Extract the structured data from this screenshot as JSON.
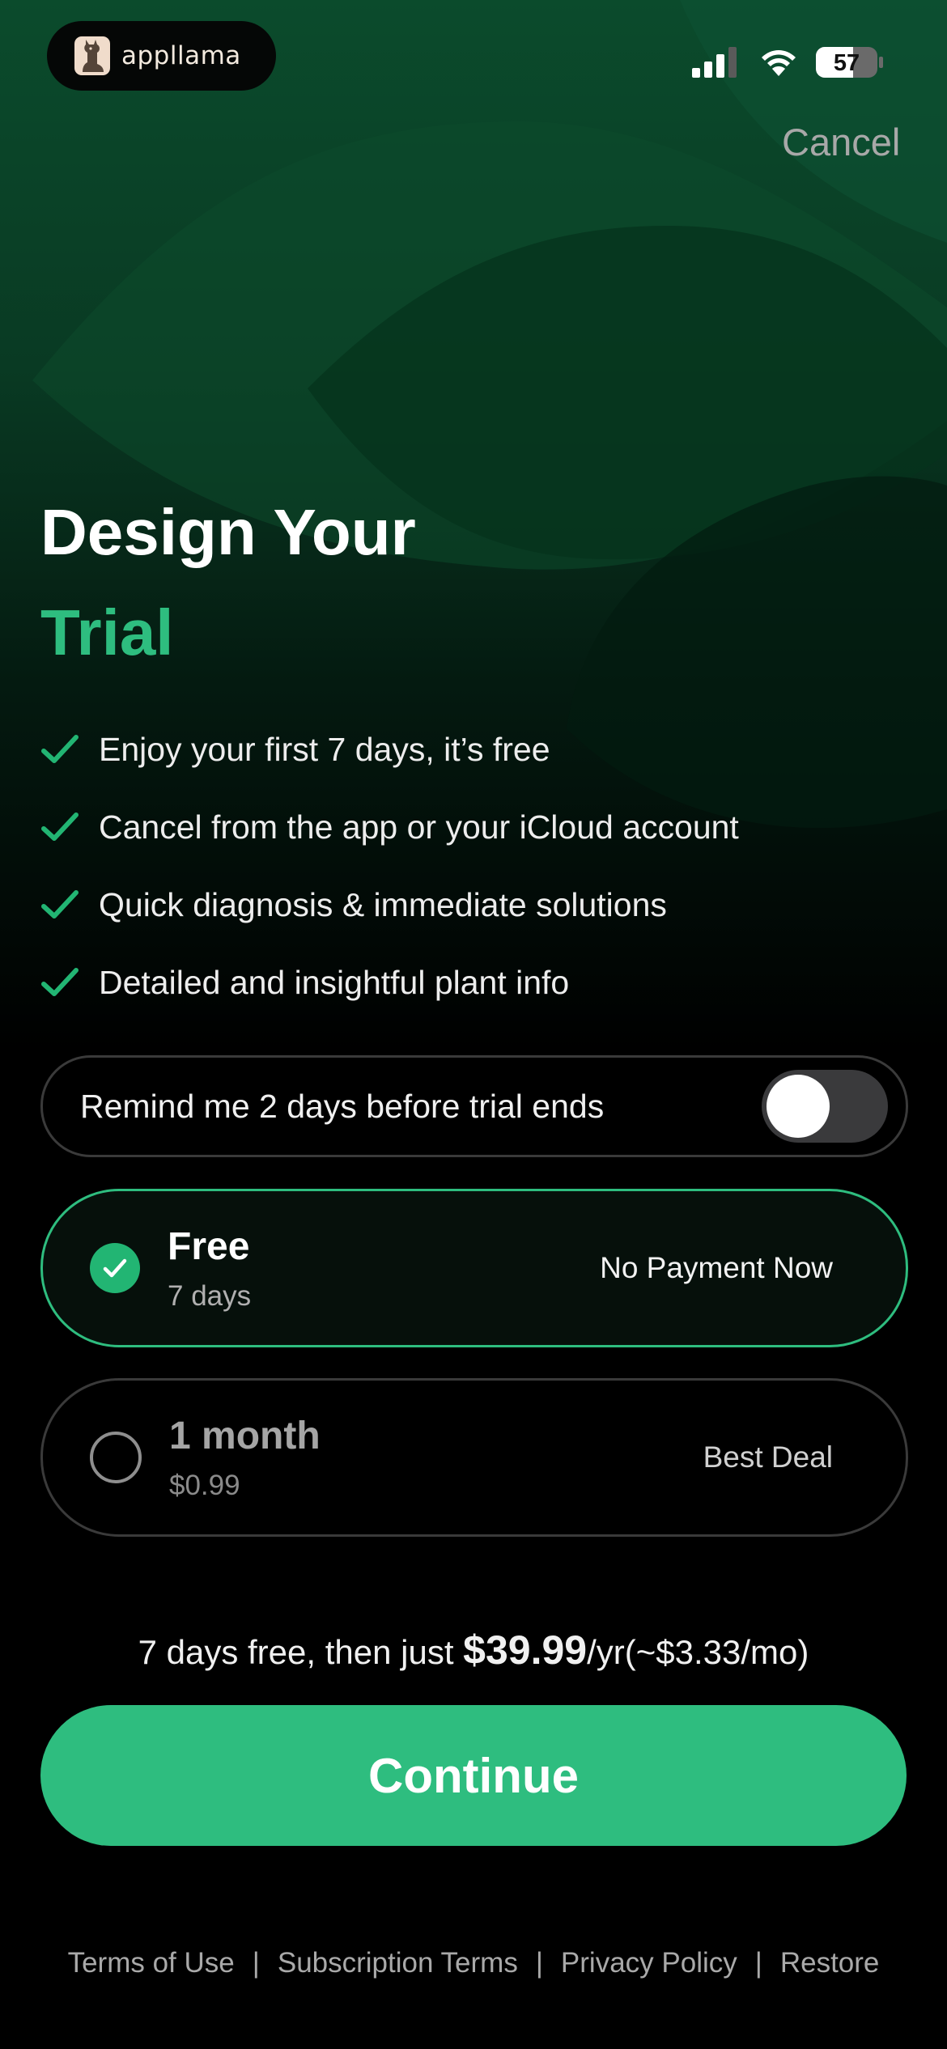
{
  "status_bar": {
    "app_name": "appllama",
    "battery": "57"
  },
  "header": {
    "cancel_label": "Cancel"
  },
  "hero": {
    "title_line1": "Design Your",
    "title_line2": "Trial"
  },
  "features": [
    "Enjoy your first 7 days, it’s free",
    "Cancel from the app or your iCloud account",
    "Quick diagnosis & immediate solutions",
    "Detailed and insightful plant info"
  ],
  "reminder": {
    "label": "Remind me 2 days before trial ends",
    "enabled": false
  },
  "plans": [
    {
      "name": "Free",
      "subtitle": "7 days",
      "badge": "No Payment Now",
      "selected": true
    },
    {
      "name": "1 month",
      "subtitle": "$0.99",
      "badge": "Best Deal",
      "selected": false
    }
  ],
  "pricing": {
    "prefix": "7 days free, then just ",
    "price": "$39.99",
    "suffix": "/yr(~$3.33/mo)"
  },
  "cta": {
    "continue_label": "Continue"
  },
  "footer": {
    "links": [
      "Terms of Use",
      "Subscription Terms",
      "Privacy Policy",
      "Restore"
    ]
  },
  "colors": {
    "accent": "#2ebd7f",
    "background": "#000000",
    "hero_green": "#0d4a2c"
  },
  "icons": {
    "check": "checkmark-icon",
    "signal": "cellular-signal-icon",
    "wifi": "wifi-icon",
    "battery": "battery-icon",
    "logo": "llama-logo-icon"
  }
}
